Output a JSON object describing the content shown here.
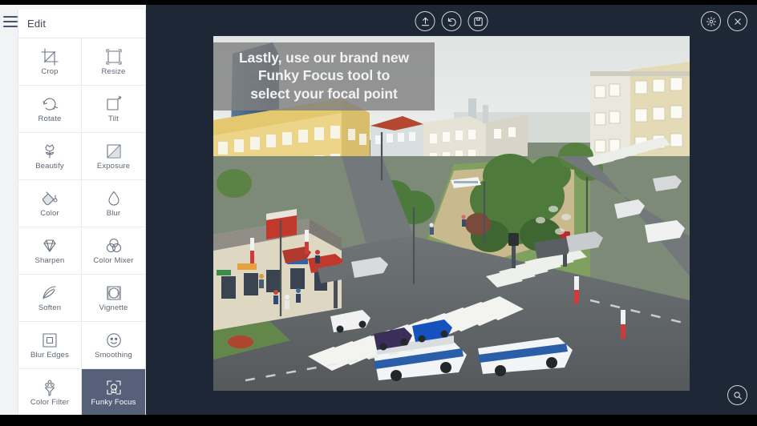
{
  "app": {
    "background_color": "#1e2735",
    "panel_background": "#ffffff",
    "accent_active": "#566078"
  },
  "sidebar": {
    "menu_icon": "hamburger-icon",
    "title": "Edit",
    "tools": [
      {
        "label": "Crop",
        "icon": "crop-icon",
        "active": false
      },
      {
        "label": "Resize",
        "icon": "resize-icon",
        "active": false
      },
      {
        "label": "Rotate",
        "icon": "rotate-icon",
        "active": false
      },
      {
        "label": "Tilt",
        "icon": "tilt-icon",
        "active": false
      },
      {
        "label": "Beautify",
        "icon": "flower-icon",
        "active": false
      },
      {
        "label": "Exposure",
        "icon": "exposure-icon",
        "active": false
      },
      {
        "label": "Color",
        "icon": "paint-bucket-icon",
        "active": false
      },
      {
        "label": "Blur",
        "icon": "droplet-icon",
        "active": false
      },
      {
        "label": "Sharpen",
        "icon": "diamond-icon",
        "active": false
      },
      {
        "label": "Color Mixer",
        "icon": "venn-circles-icon",
        "active": false
      },
      {
        "label": "Soften",
        "icon": "feather-icon",
        "active": false
      },
      {
        "label": "Vignette",
        "icon": "vignette-icon",
        "active": false
      },
      {
        "label": "Blur Edges",
        "icon": "square-frame-icon",
        "active": false
      },
      {
        "label": "Smoothing",
        "icon": "smiley-icon",
        "active": false
      },
      {
        "label": "Color Filter",
        "icon": "funnel-icon",
        "active": false
      },
      {
        "label": "Funky Focus",
        "icon": "focus-target-icon",
        "active": true
      }
    ]
  },
  "toolbar": {
    "center_buttons": [
      {
        "name": "upload-button",
        "icon": "upload-arrow-icon"
      },
      {
        "name": "undo-button",
        "icon": "undo-arrow-icon"
      },
      {
        "name": "save-button",
        "icon": "save-icon"
      }
    ],
    "right_buttons": [
      {
        "name": "settings-button",
        "icon": "gear-icon"
      },
      {
        "name": "close-button",
        "icon": "close-x-icon"
      }
    ],
    "zoom_button": {
      "name": "zoom-button",
      "icon": "magnifier-icon"
    }
  },
  "photo": {
    "caption_lines": [
      "Lastly, use our brand new",
      "Funky Focus tool to",
      "select your focal point"
    ],
    "caption_background": "#808080",
    "caption_color": "#f2f2f2",
    "alt": "Aerial view of a city street intersection with buildings, trees, buses and crosswalks"
  }
}
